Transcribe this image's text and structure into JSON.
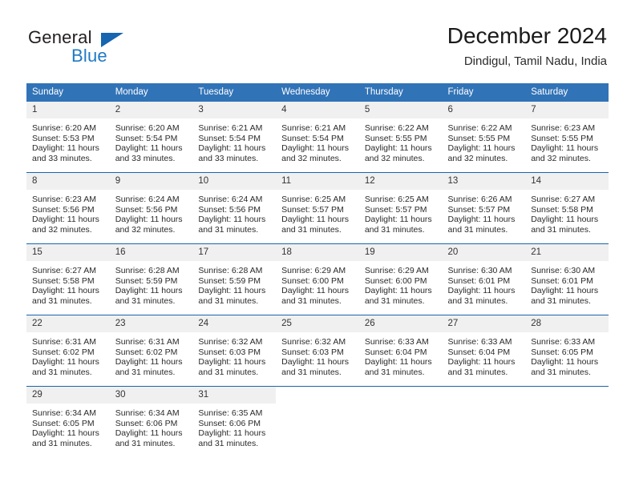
{
  "brand": {
    "name_part1": "General",
    "name_part2": "Blue",
    "triangle_color": "#1565b0",
    "blue_color": "#1f7ac4"
  },
  "header": {
    "title": "December 2024",
    "subtitle": "Dindigul, Tamil Nadu, India",
    "accent_color": "#3173b7",
    "separator_color": "#1a65ad",
    "daynum_band_color": "#f0f0f0"
  },
  "calendar": {
    "weekday_headers": [
      "Sunday",
      "Monday",
      "Tuesday",
      "Wednesday",
      "Thursday",
      "Friday",
      "Saturday"
    ],
    "weeks": [
      [
        {
          "day": "1",
          "sunrise": "Sunrise: 6:20 AM",
          "sunset": "Sunset: 5:53 PM",
          "daylight": "Daylight: 11 hours and 33 minutes."
        },
        {
          "day": "2",
          "sunrise": "Sunrise: 6:20 AM",
          "sunset": "Sunset: 5:54 PM",
          "daylight": "Daylight: 11 hours and 33 minutes."
        },
        {
          "day": "3",
          "sunrise": "Sunrise: 6:21 AM",
          "sunset": "Sunset: 5:54 PM",
          "daylight": "Daylight: 11 hours and 33 minutes."
        },
        {
          "day": "4",
          "sunrise": "Sunrise: 6:21 AM",
          "sunset": "Sunset: 5:54 PM",
          "daylight": "Daylight: 11 hours and 32 minutes."
        },
        {
          "day": "5",
          "sunrise": "Sunrise: 6:22 AM",
          "sunset": "Sunset: 5:55 PM",
          "daylight": "Daylight: 11 hours and 32 minutes."
        },
        {
          "day": "6",
          "sunrise": "Sunrise: 6:22 AM",
          "sunset": "Sunset: 5:55 PM",
          "daylight": "Daylight: 11 hours and 32 minutes."
        },
        {
          "day": "7",
          "sunrise": "Sunrise: 6:23 AM",
          "sunset": "Sunset: 5:55 PM",
          "daylight": "Daylight: 11 hours and 32 minutes."
        }
      ],
      [
        {
          "day": "8",
          "sunrise": "Sunrise: 6:23 AM",
          "sunset": "Sunset: 5:56 PM",
          "daylight": "Daylight: 11 hours and 32 minutes."
        },
        {
          "day": "9",
          "sunrise": "Sunrise: 6:24 AM",
          "sunset": "Sunset: 5:56 PM",
          "daylight": "Daylight: 11 hours and 32 minutes."
        },
        {
          "day": "10",
          "sunrise": "Sunrise: 6:24 AM",
          "sunset": "Sunset: 5:56 PM",
          "daylight": "Daylight: 11 hours and 31 minutes."
        },
        {
          "day": "11",
          "sunrise": "Sunrise: 6:25 AM",
          "sunset": "Sunset: 5:57 PM",
          "daylight": "Daylight: 11 hours and 31 minutes."
        },
        {
          "day": "12",
          "sunrise": "Sunrise: 6:25 AM",
          "sunset": "Sunset: 5:57 PM",
          "daylight": "Daylight: 11 hours and 31 minutes."
        },
        {
          "day": "13",
          "sunrise": "Sunrise: 6:26 AM",
          "sunset": "Sunset: 5:57 PM",
          "daylight": "Daylight: 11 hours and 31 minutes."
        },
        {
          "day": "14",
          "sunrise": "Sunrise: 6:27 AM",
          "sunset": "Sunset: 5:58 PM",
          "daylight": "Daylight: 11 hours and 31 minutes."
        }
      ],
      [
        {
          "day": "15",
          "sunrise": "Sunrise: 6:27 AM",
          "sunset": "Sunset: 5:58 PM",
          "daylight": "Daylight: 11 hours and 31 minutes."
        },
        {
          "day": "16",
          "sunrise": "Sunrise: 6:28 AM",
          "sunset": "Sunset: 5:59 PM",
          "daylight": "Daylight: 11 hours and 31 minutes."
        },
        {
          "day": "17",
          "sunrise": "Sunrise: 6:28 AM",
          "sunset": "Sunset: 5:59 PM",
          "daylight": "Daylight: 11 hours and 31 minutes."
        },
        {
          "day": "18",
          "sunrise": "Sunrise: 6:29 AM",
          "sunset": "Sunset: 6:00 PM",
          "daylight": "Daylight: 11 hours and 31 minutes."
        },
        {
          "day": "19",
          "sunrise": "Sunrise: 6:29 AM",
          "sunset": "Sunset: 6:00 PM",
          "daylight": "Daylight: 11 hours and 31 minutes."
        },
        {
          "day": "20",
          "sunrise": "Sunrise: 6:30 AM",
          "sunset": "Sunset: 6:01 PM",
          "daylight": "Daylight: 11 hours and 31 minutes."
        },
        {
          "day": "21",
          "sunrise": "Sunrise: 6:30 AM",
          "sunset": "Sunset: 6:01 PM",
          "daylight": "Daylight: 11 hours and 31 minutes."
        }
      ],
      [
        {
          "day": "22",
          "sunrise": "Sunrise: 6:31 AM",
          "sunset": "Sunset: 6:02 PM",
          "daylight": "Daylight: 11 hours and 31 minutes."
        },
        {
          "day": "23",
          "sunrise": "Sunrise: 6:31 AM",
          "sunset": "Sunset: 6:02 PM",
          "daylight": "Daylight: 11 hours and 31 minutes."
        },
        {
          "day": "24",
          "sunrise": "Sunrise: 6:32 AM",
          "sunset": "Sunset: 6:03 PM",
          "daylight": "Daylight: 11 hours and 31 minutes."
        },
        {
          "day": "25",
          "sunrise": "Sunrise: 6:32 AM",
          "sunset": "Sunset: 6:03 PM",
          "daylight": "Daylight: 11 hours and 31 minutes."
        },
        {
          "day": "26",
          "sunrise": "Sunrise: 6:33 AM",
          "sunset": "Sunset: 6:04 PM",
          "daylight": "Daylight: 11 hours and 31 minutes."
        },
        {
          "day": "27",
          "sunrise": "Sunrise: 6:33 AM",
          "sunset": "Sunset: 6:04 PM",
          "daylight": "Daylight: 11 hours and 31 minutes."
        },
        {
          "day": "28",
          "sunrise": "Sunrise: 6:33 AM",
          "sunset": "Sunset: 6:05 PM",
          "daylight": "Daylight: 11 hours and 31 minutes."
        }
      ],
      [
        {
          "day": "29",
          "sunrise": "Sunrise: 6:34 AM",
          "sunset": "Sunset: 6:05 PM",
          "daylight": "Daylight: 11 hours and 31 minutes."
        },
        {
          "day": "30",
          "sunrise": "Sunrise: 6:34 AM",
          "sunset": "Sunset: 6:06 PM",
          "daylight": "Daylight: 11 hours and 31 minutes."
        },
        {
          "day": "31",
          "sunrise": "Sunrise: 6:35 AM",
          "sunset": "Sunset: 6:06 PM",
          "daylight": "Daylight: 11 hours and 31 minutes."
        },
        {
          "day": "",
          "sunrise": "",
          "sunset": "",
          "daylight": ""
        },
        {
          "day": "",
          "sunrise": "",
          "sunset": "",
          "daylight": ""
        },
        {
          "day": "",
          "sunrise": "",
          "sunset": "",
          "daylight": ""
        },
        {
          "day": "",
          "sunrise": "",
          "sunset": "",
          "daylight": ""
        }
      ]
    ]
  }
}
